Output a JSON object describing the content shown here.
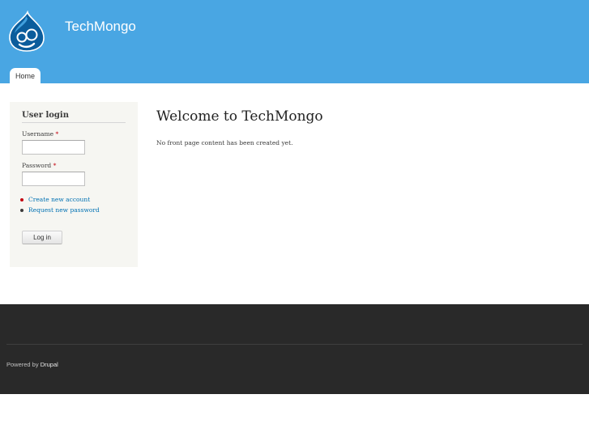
{
  "header": {
    "site_name": "TechMongo",
    "menu": {
      "home_label": "Home"
    }
  },
  "sidebar": {
    "block_title": "User login",
    "username_label": "Username",
    "password_label": "Password",
    "required_mark": "*",
    "username_value": "",
    "password_value": "",
    "links": {
      "create_account": "Create new account",
      "request_password": "Request new password"
    },
    "login_button": "Log in"
  },
  "main": {
    "title": "Welcome to TechMongo",
    "text": "No front page content has been created yet."
  },
  "footer": {
    "powered_by_prefix": "Powered by",
    "powered_by_link": "Drupal"
  },
  "colors": {
    "header_bg": "#49a6e3",
    "link": "#0071b3",
    "required": "#c3000e",
    "footer_bg": "#292929",
    "sidebar_bg": "#f6f6f2"
  },
  "icons": {
    "logo": "drupal-drop-logo"
  }
}
